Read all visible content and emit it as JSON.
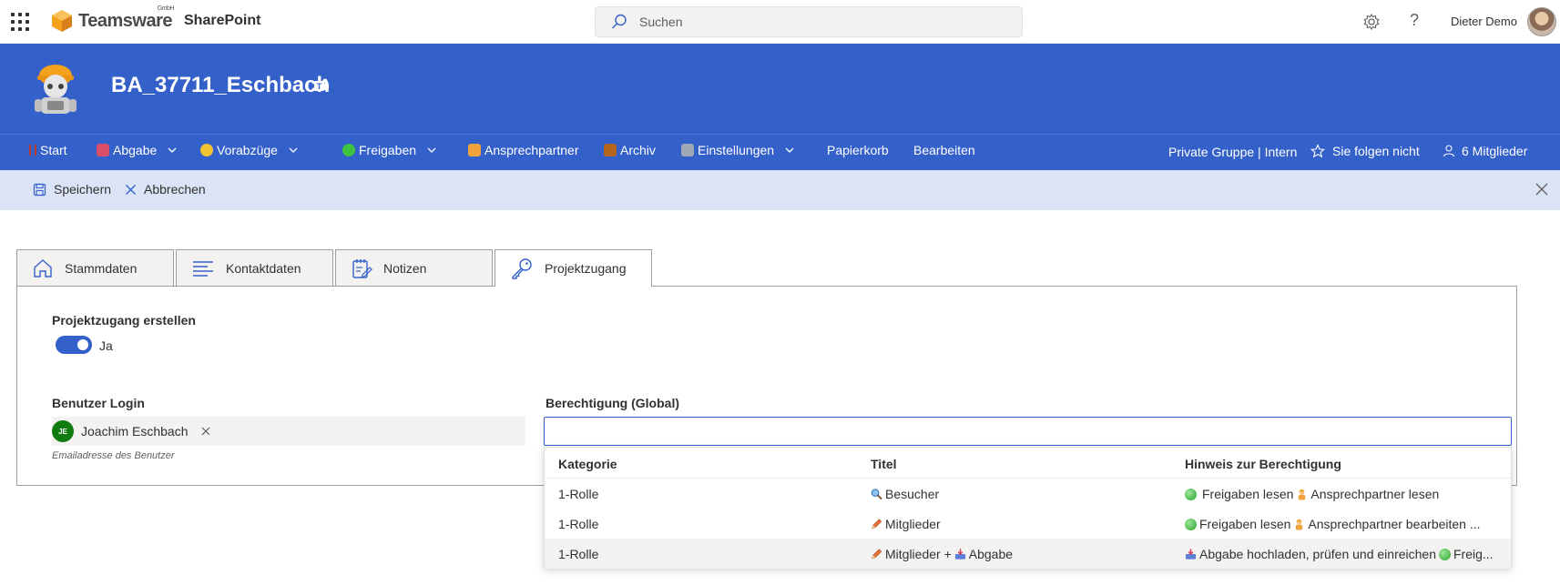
{
  "suite": {
    "logo_text": "Teamsware",
    "logo_sup": "GmbH",
    "app_name": "SharePoint",
    "search_placeholder": "Suchen",
    "user_name": "Dieter Demo"
  },
  "site": {
    "title": "BA_37711_Eschbach"
  },
  "nav": {
    "items": [
      {
        "label": "Start"
      },
      {
        "label": "Abgabe"
      },
      {
        "label": "Vorabzüge"
      },
      {
        "label": "Freigaben"
      },
      {
        "label": "Ansprechpartner"
      },
      {
        "label": "Archiv"
      },
      {
        "label": "Einstellungen"
      },
      {
        "label": "Papierkorb"
      },
      {
        "label": "Bearbeiten"
      }
    ],
    "privacy": "Private Gruppe | Intern",
    "follow": "Sie folgen nicht",
    "members": "6 Mitglieder"
  },
  "commands": {
    "save": "Speichern",
    "cancel": "Abbrechen"
  },
  "tabs": [
    {
      "label": "Stammdaten"
    },
    {
      "label": "Kontaktdaten"
    },
    {
      "label": "Notizen"
    },
    {
      "label": "Projektzugang"
    }
  ],
  "form": {
    "create_access_label": "Projektzugang erstellen",
    "toggle_value": "Ja",
    "user_login_label": "Benutzer Login",
    "persona_initials": "JE",
    "persona_name": "Joachim Eschbach",
    "user_login_hint": "Emailadresse des Benutzer",
    "permission_label": "Berechtigung (Global)"
  },
  "dropdown": {
    "headers": [
      "Kategorie",
      "Titel",
      "Hinweis zur Berechtigung"
    ],
    "rows": [
      {
        "kategorie": "1-Rolle",
        "titel": "Besucher",
        "hinweis_a": "Freigaben lesen",
        "hinweis_b": "Ansprechpartner lesen"
      },
      {
        "kategorie": "1-Rolle",
        "titel": "Mitglieder",
        "hinweis_a": "Freigaben lesen",
        "hinweis_b": "Ansprechpartner bearbeiten ..."
      },
      {
        "kategorie": "1-Rolle",
        "titel_a": "Mitglieder +",
        "titel_b": "Abgabe",
        "hinweis_a": "Abgabe hochladen, prüfen und einreichen",
        "hinweis_b": "Freig..."
      }
    ]
  },
  "colors": {
    "brand": "#3460ca",
    "command_bar": "#dbe3f6",
    "persona": "#107c10"
  }
}
